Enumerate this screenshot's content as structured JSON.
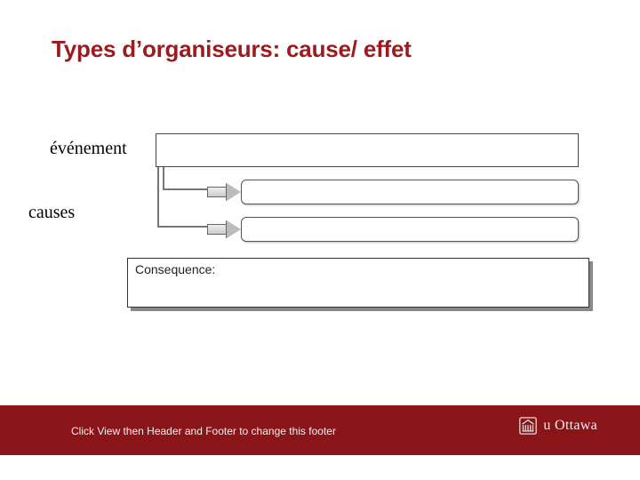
{
  "title": "Types d’organiseurs: cause/ effet",
  "labels": {
    "event": "événement",
    "causes": "causes",
    "consequence": "Consequence:"
  },
  "footer": {
    "hint": "Click View then Header and Footer to change this footer",
    "logo_text": "u Ottawa"
  },
  "colors": {
    "accent": "#9b1b1f",
    "footer": "#8a1519"
  }
}
